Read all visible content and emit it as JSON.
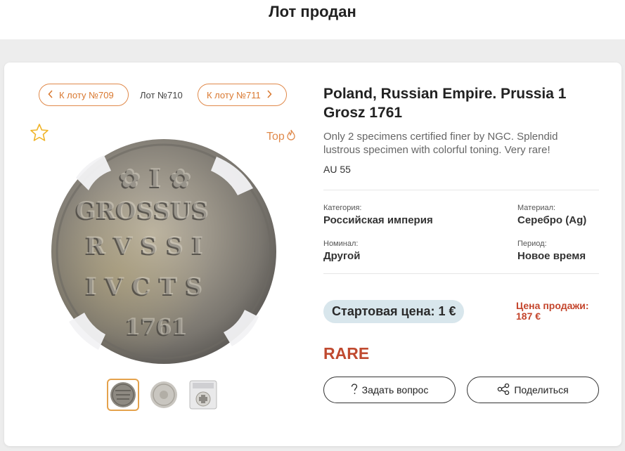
{
  "header": {
    "title": "Лот продан"
  },
  "nav": {
    "prev_label": "К лоту №709",
    "current_label": "Лот №710",
    "next_label": "К лоту №711"
  },
  "badge": {
    "top_label": "Top"
  },
  "lot": {
    "title": "Poland, Russian Empire. Prussia 1 Grosz 1761",
    "description": "Only 2 specimens certified finer by NGC. Splendid lustrous specimen with colorful toning. Very rare!",
    "grade": "AU 55"
  },
  "attributes": {
    "category_label": "Категория:",
    "category_value": "Российская империя",
    "material_label": "Материал:",
    "material_value": "Серебро (Ag)",
    "denomination_label": "Номинал:",
    "denomination_value": "Другой",
    "period_label": "Период:",
    "period_value": "Новое время"
  },
  "pricing": {
    "start_price": "Стартовая цена: 1 €",
    "sale_price_line1": "Цена продажи:",
    "sale_price_line2": "187 €"
  },
  "rarity": "RARE",
  "actions": {
    "ask_label": "Задать вопрос",
    "share_label": "Поделиться"
  },
  "colors": {
    "accent": "#e0894a",
    "sale": "#c4452c",
    "rare": "#c04a30",
    "start_pill_bg": "#d8e6ec"
  }
}
